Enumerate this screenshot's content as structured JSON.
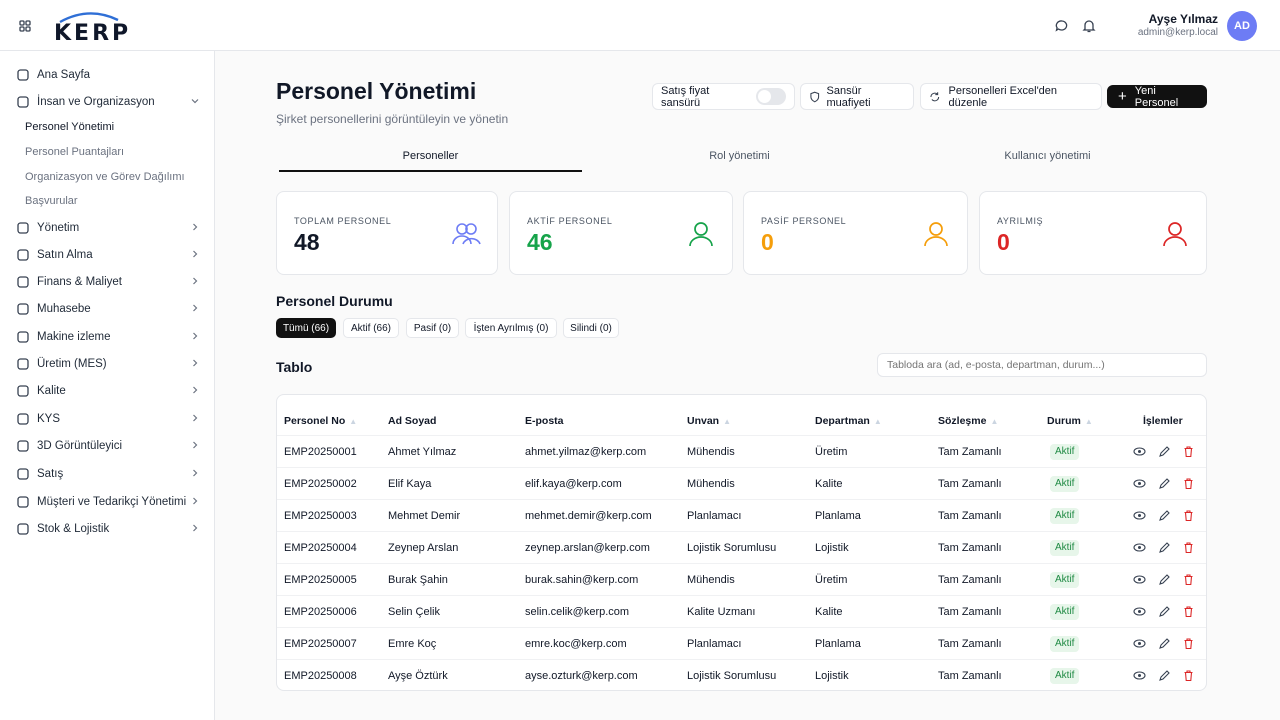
{
  "header": {
    "logo": "KERP",
    "user_name": "Ayşe Yılmaz",
    "user_email": "admin@kerp.local",
    "avatar_initials": "AD"
  },
  "sidebar": {
    "items": [
      {
        "label": "Ana Sayfa",
        "icon": "home-icon"
      },
      {
        "label": "İnsan ve Organizasyon",
        "icon": "users-icon",
        "expanded": true
      },
      {
        "label": "Yönetim",
        "icon": "gear-icon"
      },
      {
        "label": "Satın Alma",
        "icon": "handshake-icon"
      },
      {
        "label": "Finans & Maliyet",
        "icon": "finance-icon"
      },
      {
        "label": "Muhasebe",
        "icon": "ledger-icon"
      },
      {
        "label": "Makine izleme",
        "icon": "machine-icon"
      },
      {
        "label": "Üretim (MES)",
        "icon": "factory-icon"
      },
      {
        "label": "Kalite",
        "icon": "shield-check-icon"
      },
      {
        "label": "KYS",
        "icon": "shield-icon"
      },
      {
        "label": "3D Görüntüleyici",
        "icon": "cube-icon"
      },
      {
        "label": "Satış",
        "icon": "cart-icon"
      },
      {
        "label": "Müşteri ve Tedarikçi Yönetimi",
        "icon": "contacts-icon"
      },
      {
        "label": "Stok & Lojistik",
        "icon": "box-icon"
      }
    ],
    "sub_items": [
      "Personel Yönetimi",
      "Personel Puantajları",
      "Organizasyon ve Görev Dağılımı",
      "Başvurular"
    ]
  },
  "page": {
    "title": "Personel Yönetimi",
    "subtitle": "Şirket personellerini görüntüleyin ve yönetin"
  },
  "toolbar": {
    "price_censor": "Satış fiyat sansürü",
    "censor_exempt": "Sansür muafiyeti",
    "excel_edit": "Personelleri Excel'den düzenle",
    "new_staff": "Yeni Personel"
  },
  "tabs": [
    "Personeller",
    "Rol yönetimi",
    "Kullanıcı yönetimi"
  ],
  "stats": [
    {
      "label": "TOPLAM PERSONEL",
      "value": "48",
      "color": "#111827",
      "icon_color": "#6d7cf5"
    },
    {
      "label": "AKTİF PERSONEL",
      "value": "46",
      "color": "#16a34a",
      "icon_color": "#16a34a"
    },
    {
      "label": "PASİF PERSONEL",
      "value": "0",
      "color": "#f59e0b",
      "icon_color": "#f59e0b"
    },
    {
      "label": "AYRILMIŞ",
      "value": "0",
      "color": "#dc2626",
      "icon_color": "#dc2626"
    }
  ],
  "status_section": {
    "title": "Personel Durumu",
    "filters": [
      "Tümü (66)",
      "Aktif (66)",
      "Pasif (0)",
      "İşten Ayrılmış (0)",
      "Silindi (0)"
    ]
  },
  "table": {
    "title": "Tablo",
    "search_placeholder": "Tabloda ara (ad, e-posta, departman, durum...)",
    "columns": [
      "Personel No",
      "Ad Soyad",
      "E-posta",
      "Unvan",
      "Departman",
      "Sözleşme",
      "Durum",
      "İşlemler"
    ],
    "rows": [
      [
        "EMP20250001",
        "Ahmet Yılmaz",
        "ahmet.yilmaz@kerp.com",
        "Mühendis",
        "Üretim",
        "Tam Zamanlı",
        "Aktif"
      ],
      [
        "EMP20250002",
        "Elif Kaya",
        "elif.kaya@kerp.com",
        "Mühendis",
        "Kalite",
        "Tam Zamanlı",
        "Aktif"
      ],
      [
        "EMP20250003",
        "Mehmet Demir",
        "mehmet.demir@kerp.com",
        "Planlamacı",
        "Planlama",
        "Tam Zamanlı",
        "Aktif"
      ],
      [
        "EMP20250004",
        "Zeynep Arslan",
        "zeynep.arslan@kerp.com",
        "Lojistik Sorumlusu",
        "Lojistik",
        "Tam Zamanlı",
        "Aktif"
      ],
      [
        "EMP20250005",
        "Burak Şahin",
        "burak.sahin@kerp.com",
        "Mühendis",
        "Üretim",
        "Tam Zamanlı",
        "Aktif"
      ],
      [
        "EMP20250006",
        "Selin Çelik",
        "selin.celik@kerp.com",
        "Kalite Uzmanı",
        "Kalite",
        "Tam Zamanlı",
        "Aktif"
      ],
      [
        "EMP20250007",
        "Emre Koç",
        "emre.koc@kerp.com",
        "Planlamacı",
        "Planlama",
        "Tam Zamanlı",
        "Aktif"
      ],
      [
        "EMP20250008",
        "Ayşe Öztürk",
        "ayse.ozturk@kerp.com",
        "Lojistik Sorumlusu",
        "Lojistik",
        "Tam Zamanlı",
        "Aktif"
      ]
    ]
  }
}
